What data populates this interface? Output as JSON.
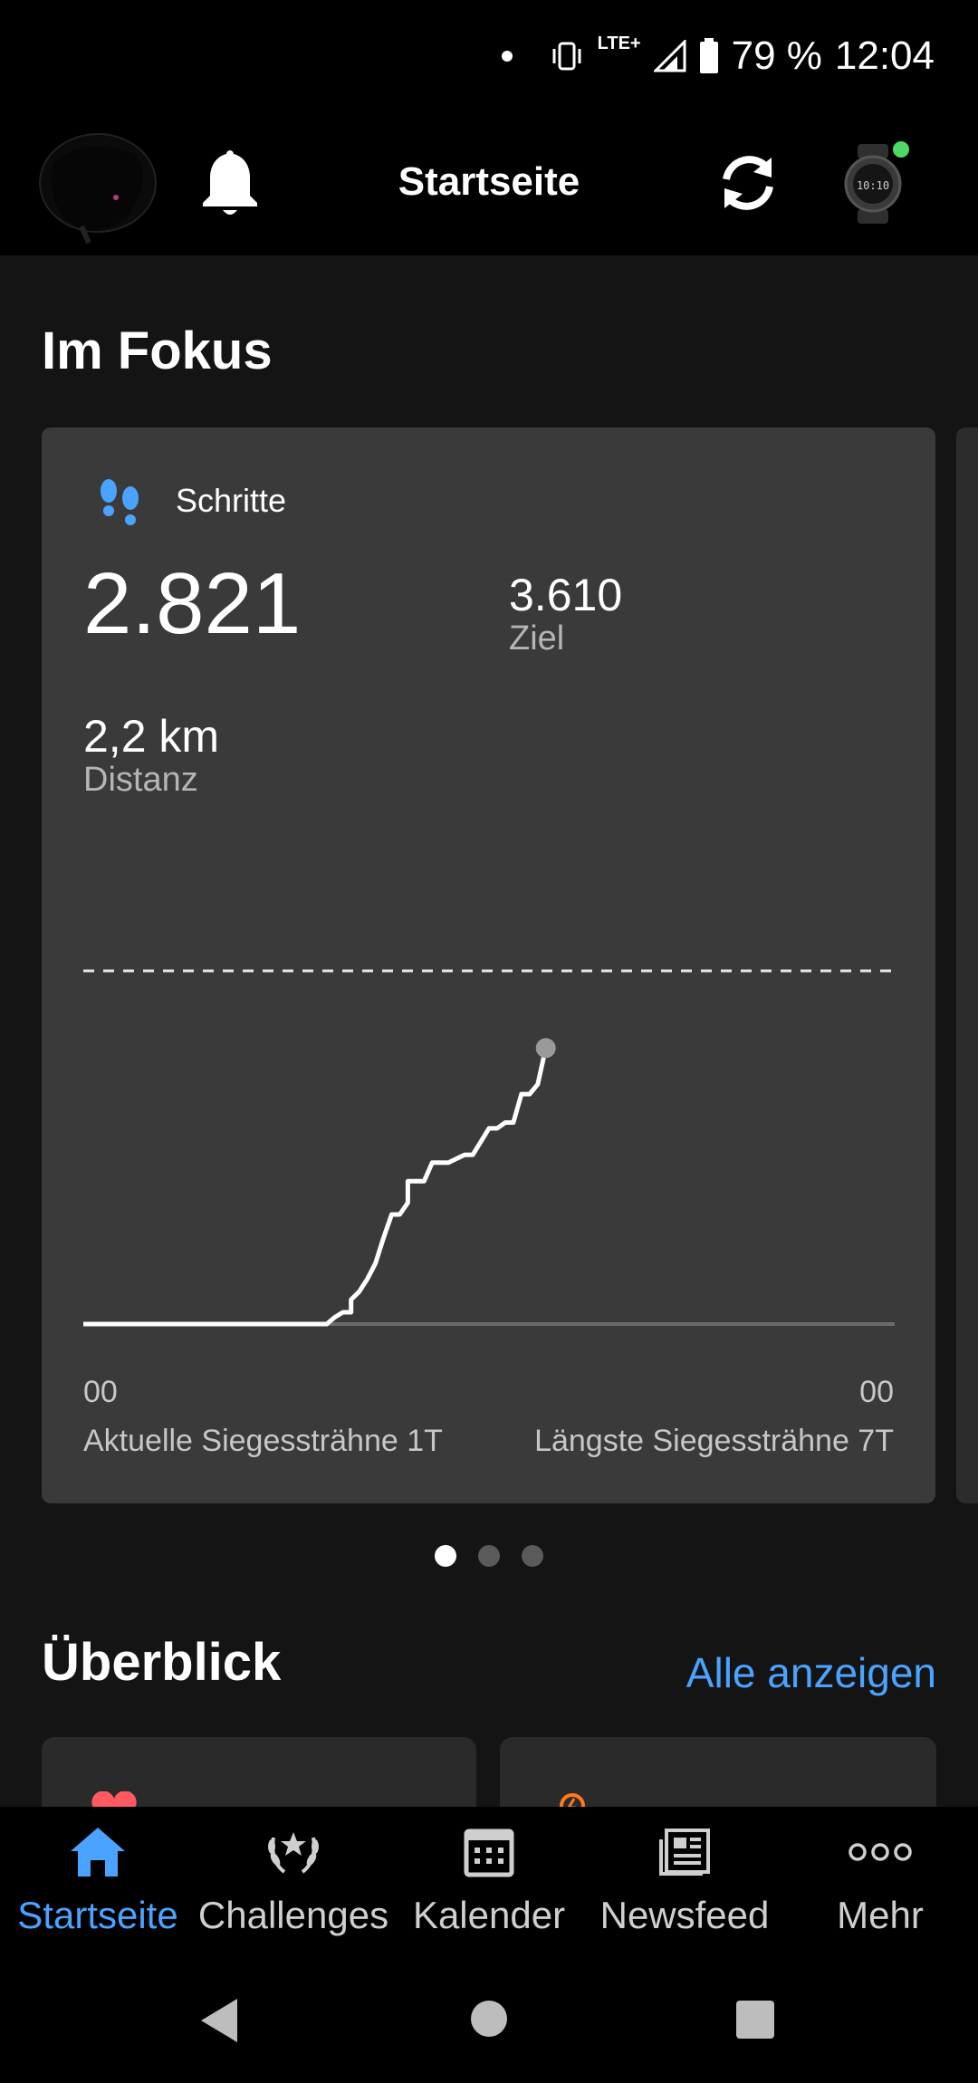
{
  "status_bar": {
    "lte": "LTE+",
    "battery": "79 %",
    "time": "12:04"
  },
  "header": {
    "title": "Startseite"
  },
  "focus": {
    "title": "Im Fokus",
    "card": {
      "label": "Schritte",
      "steps": "2.821",
      "goal_value": "3.610",
      "goal_label": "Ziel",
      "distance_value": "2,2 km",
      "distance_label": "Distanz",
      "axis_start": "00",
      "axis_end": "00",
      "current_streak": "Aktuelle Siegessträhne 1T",
      "longest_streak": "Längste Siegessträhne 7T"
    },
    "pager": {
      "count": 3,
      "active": 0
    }
  },
  "overview": {
    "title": "Überblick",
    "link": "Alle anzeigen"
  },
  "bottom_nav": {
    "items": [
      {
        "label": "Startseite",
        "icon": "home-icon",
        "active": true
      },
      {
        "label": "Challenges",
        "icon": "laurel-icon",
        "active": false
      },
      {
        "label": "Kalender",
        "icon": "calendar-icon",
        "active": false
      },
      {
        "label": "Newsfeed",
        "icon": "newsfeed-icon",
        "active": false
      },
      {
        "label": "Mehr",
        "icon": "more-icon",
        "active": false
      }
    ]
  },
  "colors": {
    "accent": "#4aa3ff",
    "card_bg": "#3a3a3a",
    "heart": "#ff5a5f",
    "energy": "#ff7a1a",
    "watch_status": "#4cd964"
  },
  "chart_data": {
    "type": "line",
    "title": "Schritte",
    "x": [
      0,
      0.3,
      0.31,
      0.32,
      0.33,
      0.33,
      0.34,
      0.35,
      0.35,
      0.36,
      0.37,
      0.37,
      0.38,
      0.39,
      0.4,
      0.4,
      0.42,
      0.43,
      0.45,
      0.46,
      0.47,
      0.48,
      0.5,
      0.51,
      0.52,
      0.53,
      0.54,
      0.55,
      0.56,
      0.57
    ],
    "y": [
      0,
      0,
      70,
      120,
      120,
      250,
      330,
      460,
      460,
      620,
      880,
      880,
      1120,
      1120,
      1240,
      1460,
      1460,
      1650,
      1650,
      1690,
      1730,
      1730,
      2000,
      2000,
      2060,
      2060,
      2350,
      2350,
      2450,
      2821
    ],
    "goal": 3610,
    "xlabel": "",
    "ylabel": "",
    "ylim": [
      0,
      3610
    ],
    "x_tick_labels": [
      "00",
      "00"
    ]
  }
}
